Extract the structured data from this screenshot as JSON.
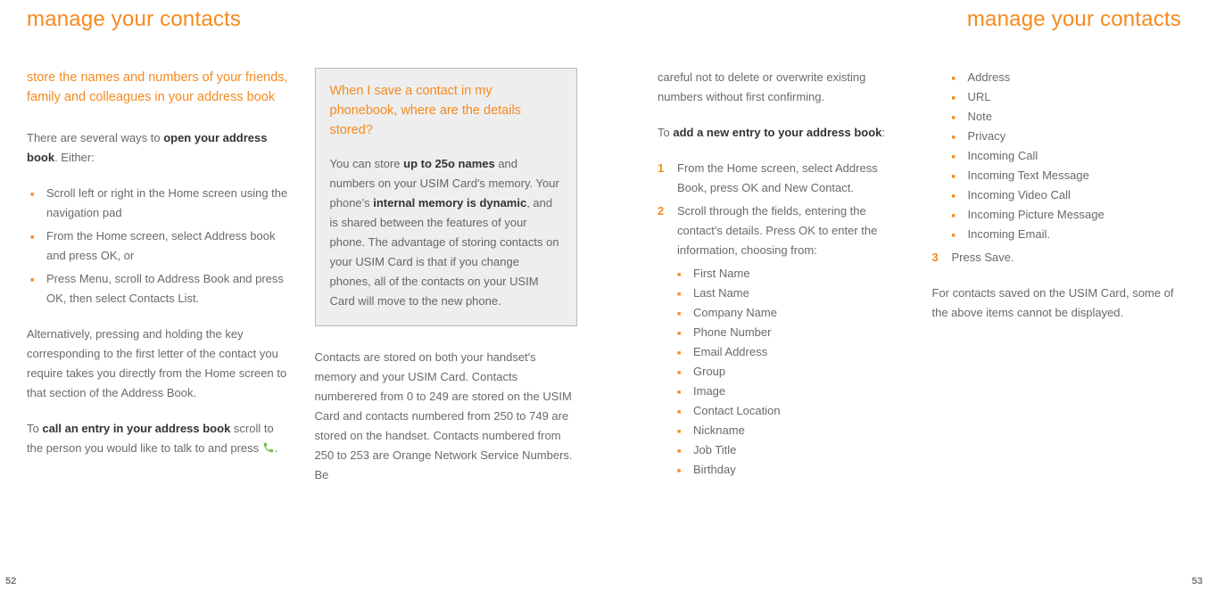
{
  "left": {
    "title": "manage your contacts",
    "pageNum": "52",
    "col1": {
      "intro1": "store the names and numbers of your friends, family and colleagues in your address book",
      "p1_pre": "There are several ways to ",
      "p1_bold": "open your address book",
      "p1_post": ". Either:",
      "bullets": [
        "Scroll left or right in the Home screen using the navigation pad",
        "From the Home screen, select Address book and press OK, or",
        "Press Menu, scroll to Address Book and press OK, then select Contacts List."
      ],
      "p2": "Alternatively, pressing and holding the key corresponding to the first letter of the contact you require takes you directly from the Home screen to that section of the Address Book.",
      "p3_pre": "To ",
      "p3_bold": "call an entry in your address book",
      "p3_post1": " scroll to the person you would like to talk to and press ",
      "p3_post2": "."
    },
    "col2": {
      "callout_q": "When I save a contact in my phonebook, where are the details stored?",
      "callout_a_pre": "You can store ",
      "callout_a_b1": "up to 25o names",
      "callout_a_mid": " and numbers on your USIM Card's memory. Your phone's ",
      "callout_a_b2": "internal memory is dynamic",
      "callout_a_post": ", and is shared between the features of your phone. The advantage of storing contacts on your USIM Card is that if you change phones, all of the contacts on your USIM Card will move to the new phone.",
      "p1": "Contacts are stored on both your handset's memory and your USIM Card. Contacts numberered from 0 to 249 are stored on the USIM Card and contacts numbered from 250 to 749 are stored on the handset. Contacts numbered from 250 to 253 are Orange Network Service Numbers. Be"
    }
  },
  "right": {
    "title": "manage your contacts",
    "pageNum": "53",
    "col1": {
      "p1": "careful not to delete or overwrite existing numbers without first confirming.",
      "p2_pre": "To ",
      "p2_bold": "add a new entry to your address book",
      "p2_post": ":",
      "step1": {
        "num": "1",
        "text": "From the Home screen, select Address Book, press OK and New Contact."
      },
      "step2": {
        "num": "2",
        "text": "Scroll through the fields, entering the contact's details. Press OK to enter the information, choosing from:"
      },
      "fields1": [
        "First Name",
        "Last Name",
        "Company Name",
        "Phone Number",
        "Email Address",
        "Group",
        "Image",
        "Contact Location",
        "Nickname",
        "Job Title",
        "Birthday"
      ]
    },
    "col2": {
      "fields2": [
        "Address",
        "URL",
        "Note",
        "Privacy",
        "Incoming Call",
        "Incoming Text Message",
        "Incoming Video Call",
        "Incoming Picture Message",
        "Incoming Email."
      ],
      "step3": {
        "num": "3",
        "text": "Press Save."
      },
      "p1": "For contacts saved on the USIM Card, some of the above items cannot be displayed."
    }
  }
}
